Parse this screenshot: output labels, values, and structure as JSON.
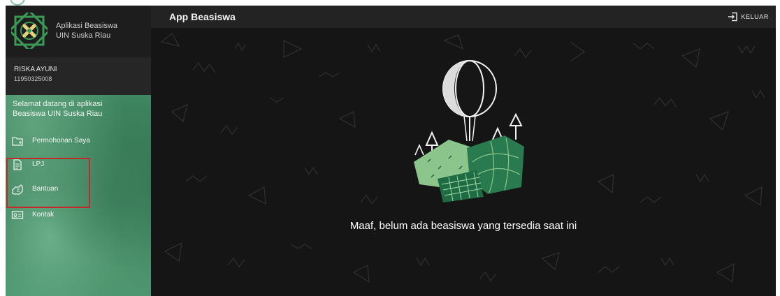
{
  "app": {
    "name_line1": "Aplikasi Beasiswa",
    "name_line2": "UIN Suska Riau"
  },
  "user": {
    "name": "RISKA AYUNI",
    "id": "11950325008"
  },
  "sidebar": {
    "welcome_line1": "Selamat datang di aplikasi",
    "welcome_line2": "Beasiswa UIN Suska Riau",
    "items": [
      {
        "label": "Permohonan Saya",
        "icon": "folder-icon"
      },
      {
        "label": "LPJ",
        "icon": "document-icon"
      },
      {
        "label": "Bantuan",
        "icon": "help-hand-icon"
      },
      {
        "label": "Kontak",
        "icon": "contact-card-icon"
      }
    ]
  },
  "topbar": {
    "title": "App Beasiswa",
    "logout_label": "KELUAR",
    "logout_icon": "logout-icon"
  },
  "main": {
    "empty_message": "Maaf, belum ada beasiswa yang tersedia saat ini",
    "illustration": "empty-state-illustration"
  },
  "colors": {
    "sidebar_green": "#3f8a62",
    "topbar": "#232323",
    "background": "#151515",
    "highlight_box": "#c62828",
    "illustration_green": "#8bc58b",
    "illustration_dark_green": "#2a7a4f"
  }
}
